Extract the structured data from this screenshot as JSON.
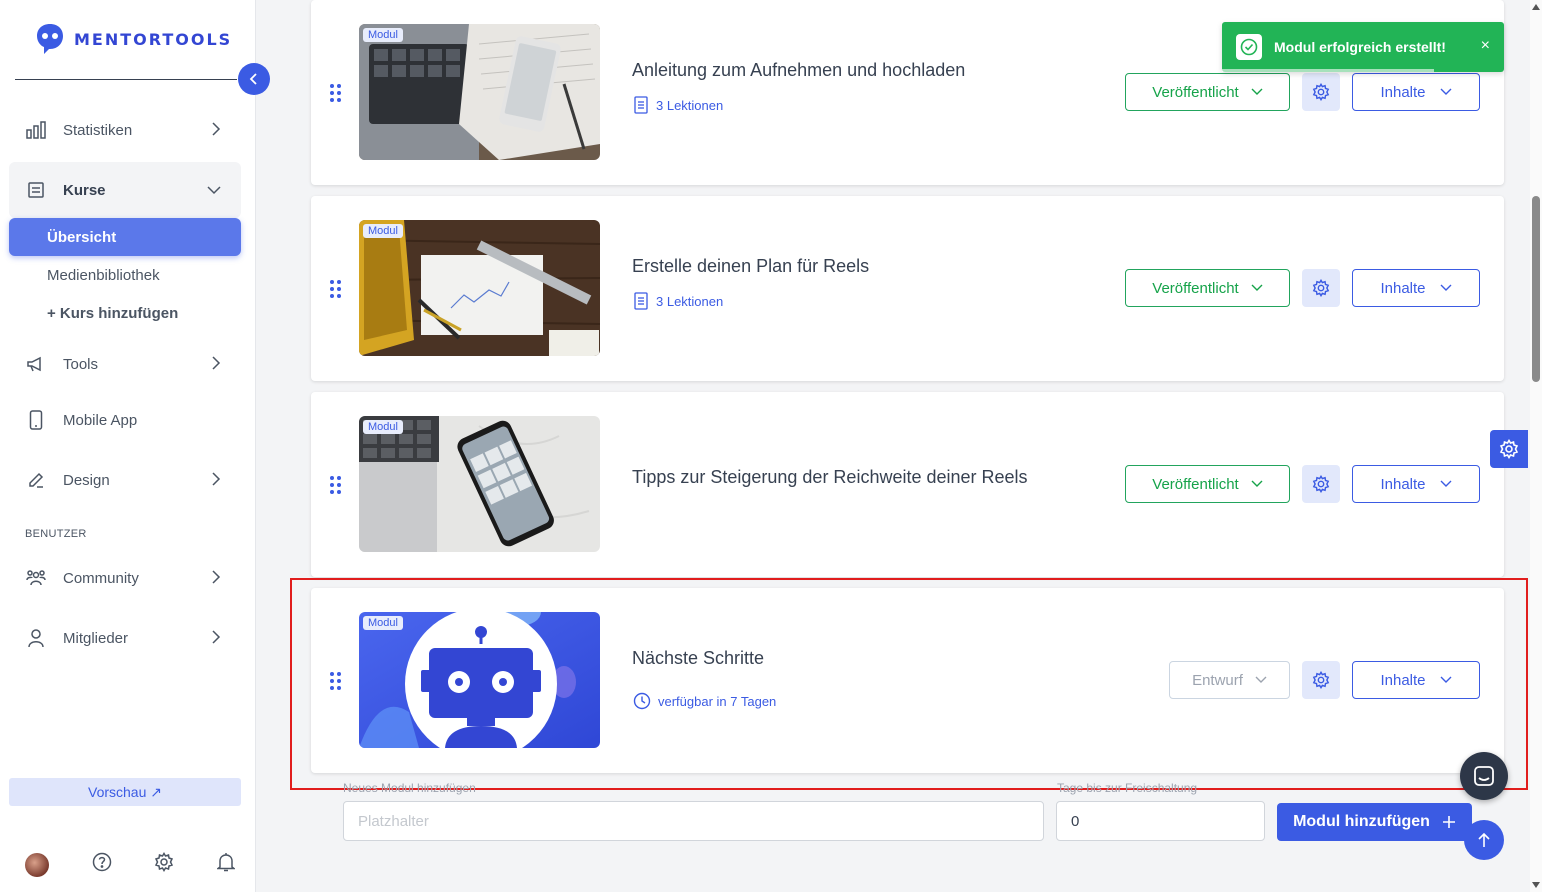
{
  "brand": {
    "name": "MENTORTOOLS",
    "color": "#3346d3"
  },
  "sidebar": {
    "items": [
      {
        "label": "Statistiken",
        "icon": "bar-chart-icon"
      },
      {
        "label": "Kurse",
        "icon": "book-icon"
      },
      {
        "label": "Tools",
        "icon": "megaphone-icon"
      },
      {
        "label": "Mobile App",
        "icon": "mobile-icon"
      },
      {
        "label": "Design",
        "icon": "pencil-icon"
      },
      {
        "label": "Community",
        "icon": "users-icon"
      },
      {
        "label": "Mitglieder",
        "icon": "user-icon"
      }
    ],
    "kurse_sub": [
      "Übersicht",
      "Medienbibliothek",
      "+ Kurs hinzufügen"
    ],
    "section_benutzer": "BENUTZER",
    "preview_label": "Vorschau ↗",
    "bottom_icons": [
      "avatar",
      "help-icon",
      "settings-icon",
      "bell-icon"
    ]
  },
  "modules": [
    {
      "badge": "Modul",
      "title": "Anleitung zum Aufnehmen und hochladen",
      "meta": "3 Lektionen",
      "status": "Veröffentlicht",
      "inhalte": "Inhalte"
    },
    {
      "badge": "Modul",
      "title": "Erstelle deinen Plan für Reels",
      "meta": "3 Lektionen",
      "status": "Veröffentlicht",
      "inhalte": "Inhalte"
    },
    {
      "badge": "Modul",
      "title": "Tipps zur Steigerung der Reichweite deiner Reels",
      "meta": "",
      "status": "Veröffentlicht",
      "inhalte": "Inhalte"
    },
    {
      "badge": "Modul",
      "title": "Nächste Schritte",
      "meta": "verfügbar in 7 Tagen",
      "status": "Entwurf",
      "inhalte": "Inhalte"
    }
  ],
  "form": {
    "new_module_label": "Neues Modul hinzufügen",
    "new_module_placeholder": "Platzhalter",
    "days_label": "Tage bis zur Freischaltung",
    "days_value": "0",
    "add_button": "Modul hinzufügen"
  },
  "toast": {
    "message": "Modul erfolgreich erstellt!",
    "close": "×",
    "progress": 0.75
  },
  "colors": {
    "accent": "#3b5be3",
    "success": "#22b456",
    "highlight": "#e11d1d"
  }
}
